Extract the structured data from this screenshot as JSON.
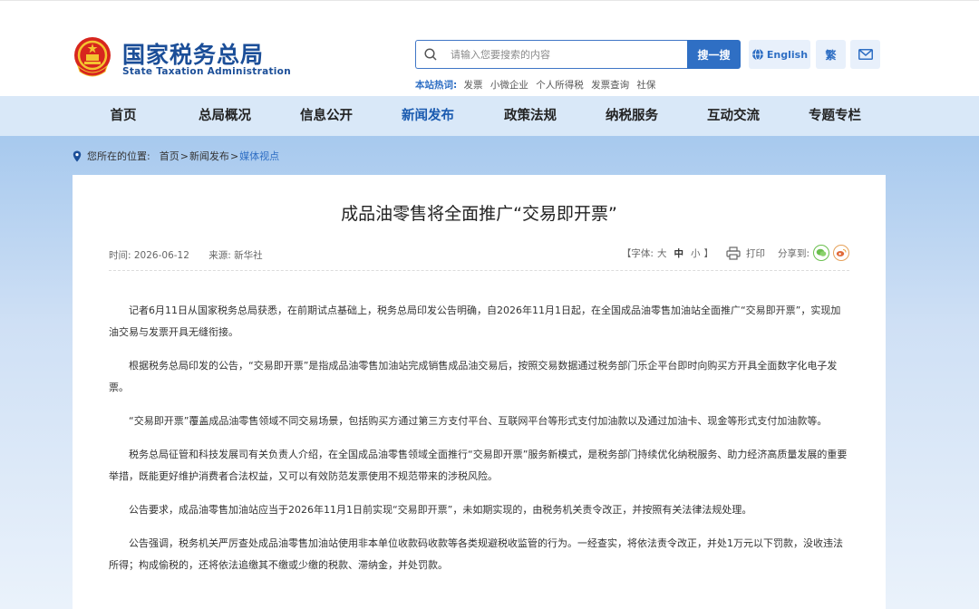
{
  "header": {
    "title": "国家税务总局",
    "subtitle": "State Taxation Administration",
    "search": {
      "placeholder": "请输入您要搜索的内容",
      "button": "搜一搜"
    },
    "hot": {
      "label": "本站热词:",
      "items": [
        "发票",
        "小微企业",
        "个人所得税",
        "发票查询",
        "社保"
      ]
    },
    "english": "English",
    "traditional": "繁"
  },
  "nav": [
    "首页",
    "总局概况",
    "信息公开",
    "新闻发布",
    "政策法规",
    "纳税服务",
    "互动交流",
    "专题专栏"
  ],
  "nav_active": "新闻发布",
  "breadcrumb": {
    "label": "您所在的位置:",
    "items": [
      "首页",
      "新闻发布",
      "媒体视点"
    ],
    "sep": ">"
  },
  "article": {
    "title": "成品油零售将全面推广“交易即开票”",
    "time": "时间: 2026-06-12",
    "source": "来源: 新华社",
    "font_label": "【字体:",
    "font_sizes": [
      "大",
      "中",
      "小"
    ],
    "font_close": "】",
    "print": "打印",
    "share": "分享到:",
    "paragraphs": [
      "记者6月11日从国家税务总局获悉，在前期试点基础上，税务总局印发公告明确，自2026年11月1日起，在全国成品油零售加油站全面推广“交易即开票”，实现加油交易与发票开具无缝衔接。",
      "根据税务总局印发的公告，“交易即开票”是指成品油零售加油站完成销售成品油交易后，按照交易数据通过税务部门乐企平台即时向购买方开具全面数字化电子发票。",
      "“交易即开票”覆盖成品油零售领域不同交易场景，包括购买方通过第三方支付平台、互联网平台等形式支付加油款以及通过加油卡、现金等形式支付加油款等。",
      "税务总局征管和科技发展司有关负责人介绍，在全国成品油零售领域全面推行“交易即开票”服务新模式，是税务部门持续优化纳税服务、助力经济高质量发展的重要举措，既能更好维护消费者合法权益，又可以有效防范发票使用不规范带来的涉税风险。",
      "公告要求，成品油零售加油站应当于2026年11月1日前实现“交易即开票”，未如期实现的，由税务机关责令改正，并按照有关法律法规处理。",
      "公告强调，税务机关严厉查处成品油零售加油站使用非本单位收款码收款等各类规避税收监管的行为。一经查实，将依法责令改正，并处1万元以下罚款，没收违法所得；构成偷税的，还将依法追缴其不缴或少缴的税款、滞纳金，并处罚款。"
    ]
  },
  "colors": {
    "brand": "#1b4e98",
    "accent": "#2f6fc4",
    "nav_bg": "#d9e8f8"
  }
}
